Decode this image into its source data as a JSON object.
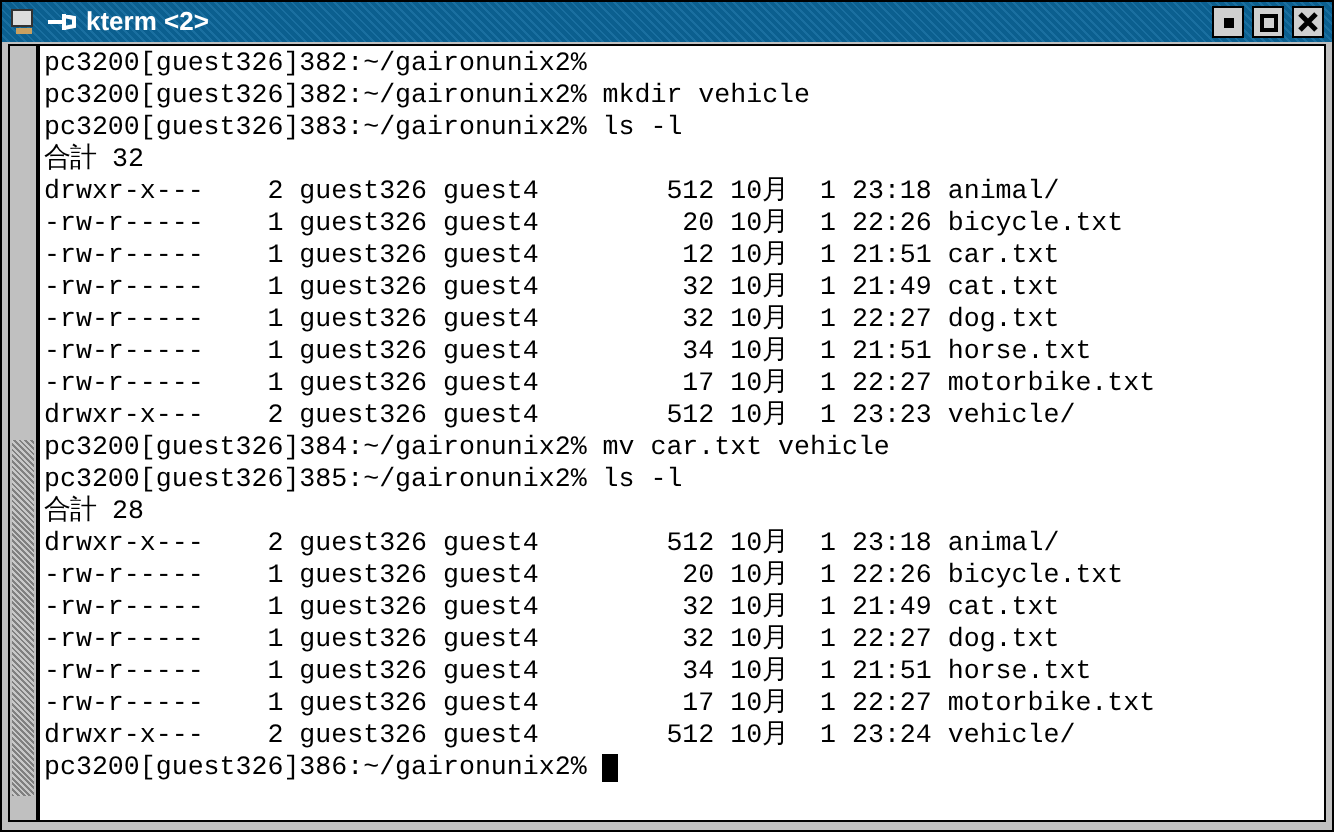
{
  "window": {
    "title": "kterm <2>"
  },
  "terminal": {
    "lines": [
      "pc3200[guest326]382:~/gaironunix2%",
      "pc3200[guest326]382:~/gaironunix2% mkdir vehicle",
      "pc3200[guest326]383:~/gaironunix2% ls -l",
      "合計 32",
      "drwxr-x---    2 guest326 guest4        512 10月  1 23:18 animal/",
      "-rw-r-----    1 guest326 guest4         20 10月  1 22:26 bicycle.txt",
      "-rw-r-----    1 guest326 guest4         12 10月  1 21:51 car.txt",
      "-rw-r-----    1 guest326 guest4         32 10月  1 21:49 cat.txt",
      "-rw-r-----    1 guest326 guest4         32 10月  1 22:27 dog.txt",
      "-rw-r-----    1 guest326 guest4         34 10月  1 21:51 horse.txt",
      "-rw-r-----    1 guest326 guest4         17 10月  1 22:27 motorbike.txt",
      "drwxr-x---    2 guest326 guest4        512 10月  1 23:23 vehicle/",
      "pc3200[guest326]384:~/gaironunix2% mv car.txt vehicle",
      "pc3200[guest326]385:~/gaironunix2% ls -l",
      "合計 28",
      "drwxr-x---    2 guest326 guest4        512 10月  1 23:18 animal/",
      "-rw-r-----    1 guest326 guest4         20 10月  1 22:26 bicycle.txt",
      "-rw-r-----    1 guest326 guest4         32 10月  1 21:49 cat.txt",
      "-rw-r-----    1 guest326 guest4         32 10月  1 22:27 dog.txt",
      "-rw-r-----    1 guest326 guest4         34 10月  1 21:51 horse.txt",
      "-rw-r-----    1 guest326 guest4         17 10月  1 22:27 motorbike.txt",
      "drwxr-x---    2 guest326 guest4        512 10月  1 23:24 vehicle/",
      "pc3200[guest326]386:~/gaironunix2% "
    ],
    "cursor": true
  }
}
